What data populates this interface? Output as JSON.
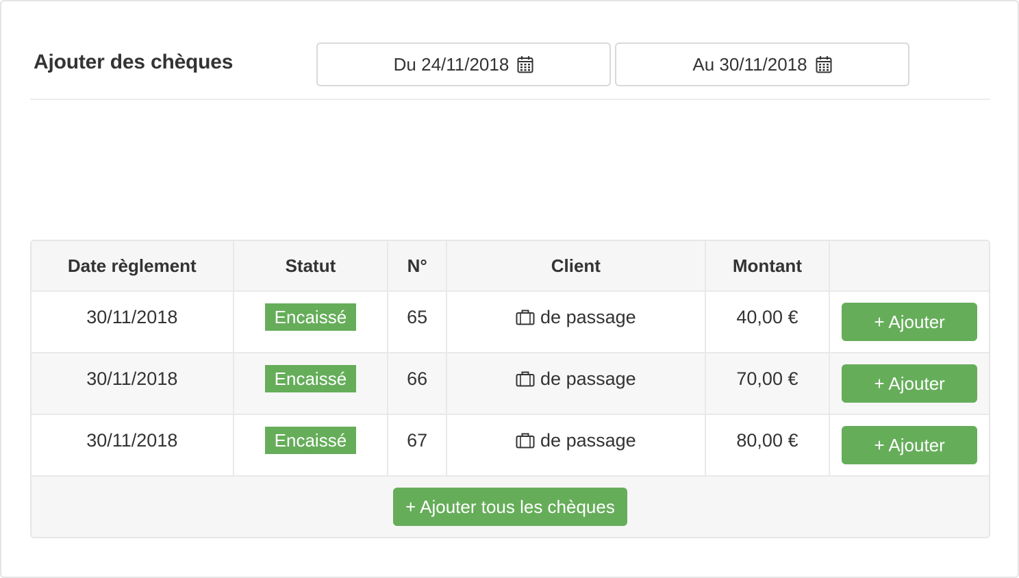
{
  "header": {
    "title": "Ajouter des chèques",
    "date_from": "Du 24/11/2018",
    "date_to": "Au 30/11/2018",
    "icon_date": "calendar-icon"
  },
  "table": {
    "columns": [
      "Date règlement",
      "Statut",
      "N°",
      "Client",
      "Montant",
      ""
    ],
    "rows": [
      {
        "date": "30/11/2018",
        "status": "Encaissé",
        "number": "65",
        "client": "de passage",
        "amount": "40,00 €",
        "action": "+ Ajouter"
      },
      {
        "date": "30/11/2018",
        "status": "Encaissé",
        "number": "66",
        "client": "de passage",
        "amount": "70,00 €",
        "action": "+ Ajouter"
      },
      {
        "date": "30/11/2018",
        "status": "Encaissé",
        "number": "67",
        "client": "de passage",
        "amount": "80,00 €",
        "action": "+ Ajouter"
      }
    ],
    "footer_button": "+ Ajouter tous les chèques"
  },
  "colors": {
    "accent_green": "#66ad5a",
    "text": "#333333",
    "border": "#e6e6e6",
    "row_alt": "#f7f7f7"
  }
}
